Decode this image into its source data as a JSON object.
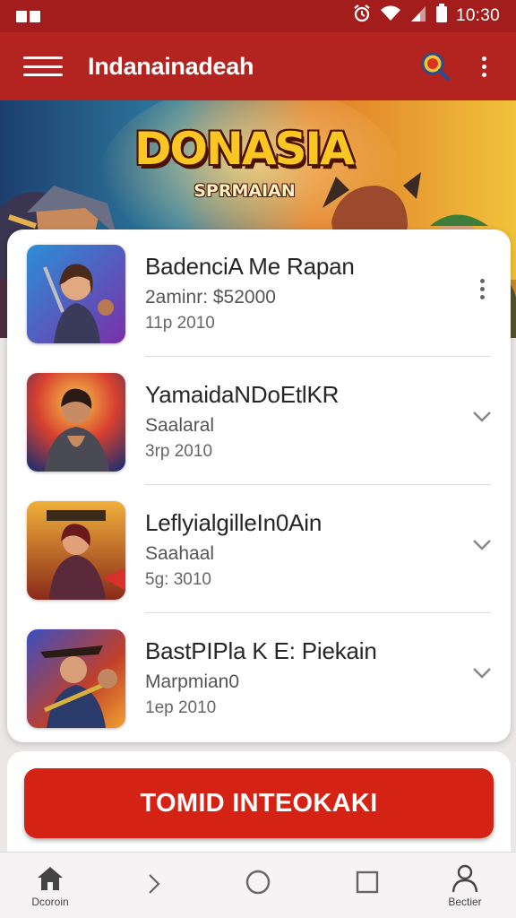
{
  "status_bar": {
    "time": "10:30"
  },
  "app_bar": {
    "title": "Indanainadeah"
  },
  "banner": {
    "title": "DONASIA",
    "subtitle": "SPRMAIAN"
  },
  "list": {
    "items": [
      {
        "title": "BadenciA Me Rapan",
        "subtitle": "2aminr: $52000",
        "meta": "11p 2010",
        "action_icon": "more-vert-icon"
      },
      {
        "title": "YamaidaNDoEtlKR",
        "subtitle": "Saalaral",
        "meta": "3rp 2010",
        "action_icon": "chevron-down-icon"
      },
      {
        "title": "LeflyialgilleIn0Ain",
        "subtitle": "Saahaal",
        "meta": "5g: 3010",
        "action_icon": "chevron-down-icon"
      },
      {
        "title": "BastPIPla K E: Piekain",
        "subtitle": "Marpmian0",
        "meta": "1ep 2010",
        "action_icon": "chevron-down-icon"
      }
    ]
  },
  "cta": {
    "label": "TOMID INTEOKAKI"
  },
  "bottom_nav": {
    "home_label": "Dcoroin",
    "profile_label": "Bectier"
  },
  "colors": {
    "primary": "#b3231f",
    "status_bar": "#a31d1d",
    "cta": "#d42314"
  }
}
